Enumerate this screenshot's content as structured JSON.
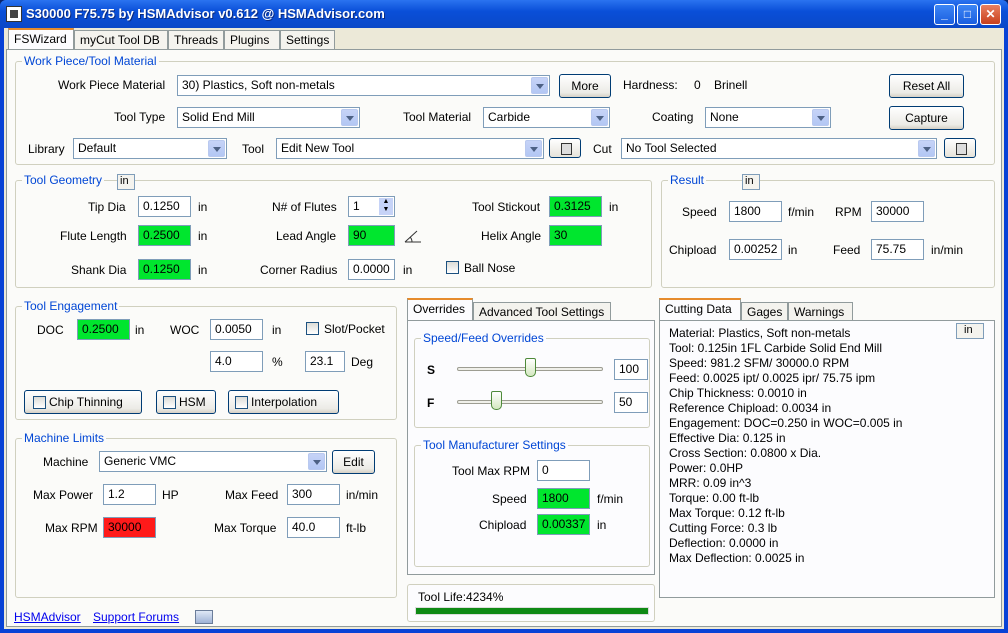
{
  "window": {
    "title": "S30000 F75.75 by HSMAdvisor v0.612 @ HSMAdvisor.com",
    "min": "_",
    "max": "□",
    "close": "✕"
  },
  "tabs": [
    "FSWizard",
    "myCut Tool DB",
    "Threads",
    "Plugins",
    "Settings"
  ],
  "wp": {
    "title": "Work Piece/Tool Material",
    "material_label": "Work Piece Material",
    "material": "30) Plastics, Soft non-metals",
    "more": "More",
    "hardness_label": "Hardness:",
    "hardness_value": "0",
    "hardness_unit": "Brinell",
    "reset": "Reset All",
    "tooltype_label": "Tool Type",
    "tooltype": "Solid End Mill",
    "toolmat_label": "Tool Material",
    "toolmat": "Carbide",
    "coating_label": "Coating",
    "coating": "None",
    "capture": "Capture",
    "library_label": "Library",
    "library": "Default",
    "tool_label": "Tool",
    "tool": "Edit New Tool",
    "cut_label": "Cut",
    "cut": "No Tool Selected"
  },
  "geom": {
    "title": "Tool Geometry",
    "unit_btn": "in",
    "tipdia_label": "Tip Dia",
    "tipdia": "0.1250",
    "in": "in",
    "flutelen_label": "Flute Length",
    "flutelen": "0.2500",
    "shank_label": "Shank Dia",
    "shank": "0.1250",
    "flutes_label": "N# of Flutes",
    "flutes": "1",
    "lead_label": "Lead Angle",
    "lead": "90",
    "corner_label": "Corner Radius",
    "corner": "0.0000",
    "stickout_label": "Tool Stickout",
    "stickout": "0.3125",
    "helix_label": "Helix Angle",
    "helix": "30",
    "ballnose": "Ball Nose"
  },
  "result": {
    "title": "Result",
    "unit_btn": "in",
    "speed_label": "Speed",
    "speed": "1800",
    "speed_unit": "f/min",
    "rpm_label": "RPM",
    "rpm": "30000",
    "chipload_label": "Chipload",
    "chipload": "0.00252",
    "chipload_unit": "in",
    "feed_label": "Feed",
    "feed": "75.75",
    "feed_unit": "in/min"
  },
  "engage": {
    "title": "Tool Engagement",
    "doc_label": "DOC",
    "doc": "0.2500",
    "in": "in",
    "woc_label": "WOC",
    "woc": "0.0050",
    "slot": "Slot/Pocket",
    "pct": "4.0",
    "pct_unit": "%",
    "deg": "23.1",
    "deg_unit": "Deg",
    "chipthin": "Chip Thinning",
    "hsm": "HSM",
    "interp": "Interpolation"
  },
  "machine": {
    "title": "Machine Limits",
    "machine_label": "Machine",
    "machine": "Generic VMC",
    "edit": "Edit",
    "maxpower_label": "Max Power",
    "maxpower": "1.2",
    "hp": "HP",
    "maxfeed_label": "Max Feed",
    "maxfeed": "300",
    "feed_unit": "in/min",
    "maxrpm_label": "Max RPM",
    "maxrpm": "30000",
    "maxtorque_label": "Max Torque",
    "maxtorque": "40.0",
    "torque_unit": "ft-lb"
  },
  "overrides": {
    "tab1": "Overrides",
    "tab2": "Advanced Tool Settings",
    "group": "Speed/Feed Overrides",
    "s_label": "S",
    "s_value": "100",
    "s_level": 0.5,
    "f_label": "F",
    "f_value": "50",
    "f_level": 0.25
  },
  "mfr": {
    "title": "Tool Manufacturer Settings",
    "maxrpm_label": "Tool Max RPM",
    "maxrpm": "0",
    "speed_label": "Speed",
    "speed": "1800",
    "speed_unit": "f/min",
    "chipload_label": "Chipload",
    "chipload": "0.00337",
    "chipload_unit": "in"
  },
  "toollife": {
    "label": "Tool Life:4234%",
    "level": 1.0
  },
  "cutting": {
    "tab1": "Cutting Data",
    "tab2": "Gages",
    "tab3": "Warnings",
    "unit_btn": "in",
    "lines": [
      "Material: Plastics, Soft non-metals",
      "Tool: 0.125in 1FL Carbide  Solid End Mill",
      "Speed: 981.2 SFM/ 30000.0 RPM",
      "Feed: 0.0025 ipt/ 0.0025 ipr/ 75.75 ipm",
      "Chip Thickness: 0.0010 in",
      "Reference Chipload: 0.0034 in",
      "Engagement:  DOC=0.250 in   WOC=0.005 in",
      "Effective Dia: 0.125 in",
      "Cross Section: 0.0800 x Dia.",
      "Power: 0.0HP",
      "MRR: 0.09 in^3",
      "Torque: 0.00 ft-lb",
      "Max Torque: 0.12 ft-lb",
      "Cutting Force: 0.3 lb",
      "Deflection: 0.0000 in",
      "Max Deflection: 0.0025 in"
    ]
  },
  "footer": {
    "link1": "HSMAdvisor",
    "link2": "Support Forums"
  },
  "colors": {
    "green": "#00e62e",
    "red": "#ff1a1a",
    "accent": "#0046d5"
  }
}
